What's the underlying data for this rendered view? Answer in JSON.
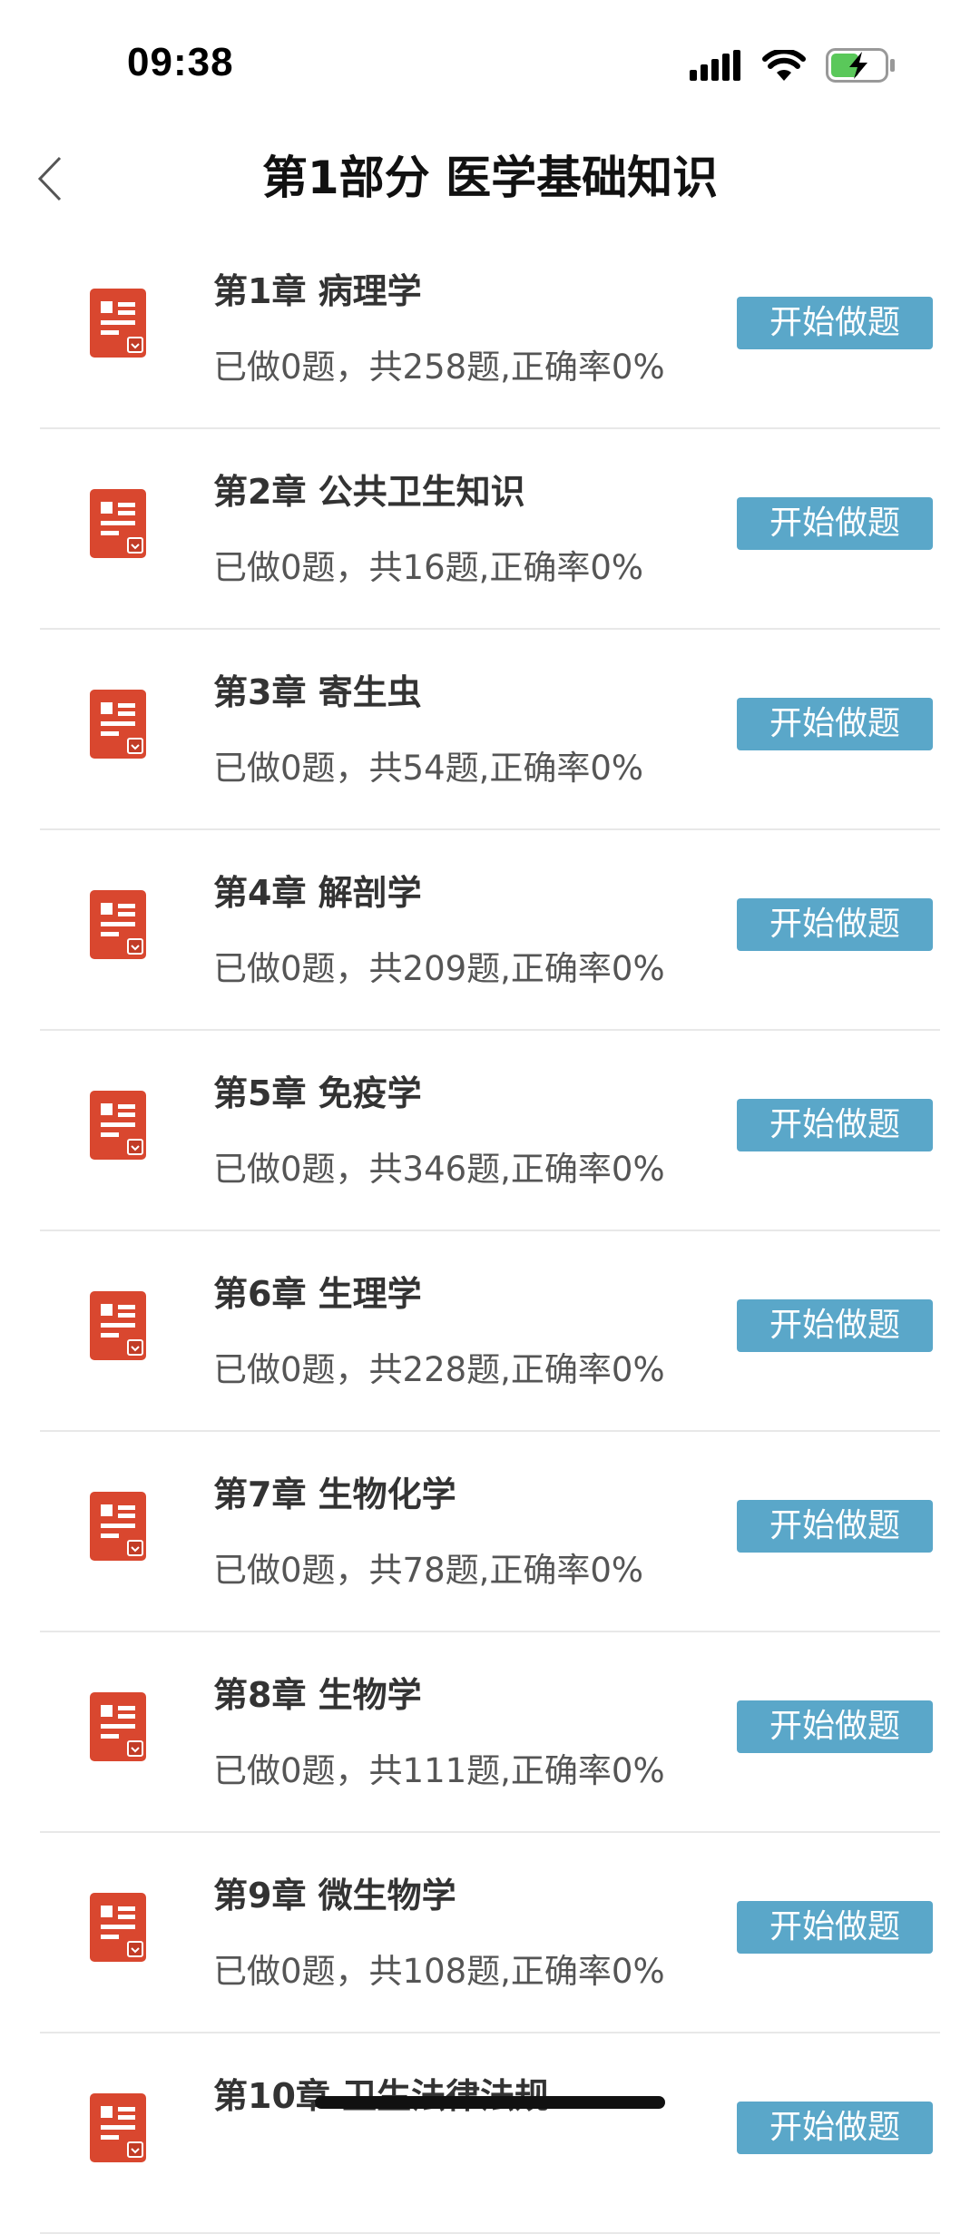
{
  "status_bar": {
    "time": "09:38",
    "icons": [
      "signal-icon",
      "wifi-icon",
      "battery-charging-icon"
    ]
  },
  "nav": {
    "title": "第1部分 医学基础知识",
    "back_icon": "chevron-left-icon"
  },
  "colors": {
    "icon_red": "#d9472f",
    "button_blue": "#5aa7c9",
    "battery_green": "#5ac85a"
  },
  "chapters": [
    {
      "title": "第1章  病理学",
      "progress": "已做0题，共258题,正确率0%",
      "button": "开始做题"
    },
    {
      "title": "第2章  公共卫生知识",
      "progress": "已做0题，共16题,正确率0%",
      "button": "开始做题"
    },
    {
      "title": "第3章  寄生虫",
      "progress": "已做0题，共54题,正确率0%",
      "button": "开始做题"
    },
    {
      "title": "第4章  解剖学",
      "progress": "已做0题，共209题,正确率0%",
      "button": "开始做题"
    },
    {
      "title": "第5章  免疫学",
      "progress": "已做0题，共346题,正确率0%",
      "button": "开始做题"
    },
    {
      "title": "第6章  生理学",
      "progress": "已做0题，共228题,正确率0%",
      "button": "开始做题"
    },
    {
      "title": "第7章  生物化学",
      "progress": "已做0题，共78题,正确率0%",
      "button": "开始做题"
    },
    {
      "title": "第8章  生物学",
      "progress": "已做0题，共111题,正确率0%",
      "button": "开始做题"
    },
    {
      "title": "第9章  微生物学",
      "progress": "已做0题，共108题,正确率0%",
      "button": "开始做题"
    },
    {
      "title": "第10章  卫生法律法规",
      "progress": "",
      "button": "开始做题"
    }
  ]
}
